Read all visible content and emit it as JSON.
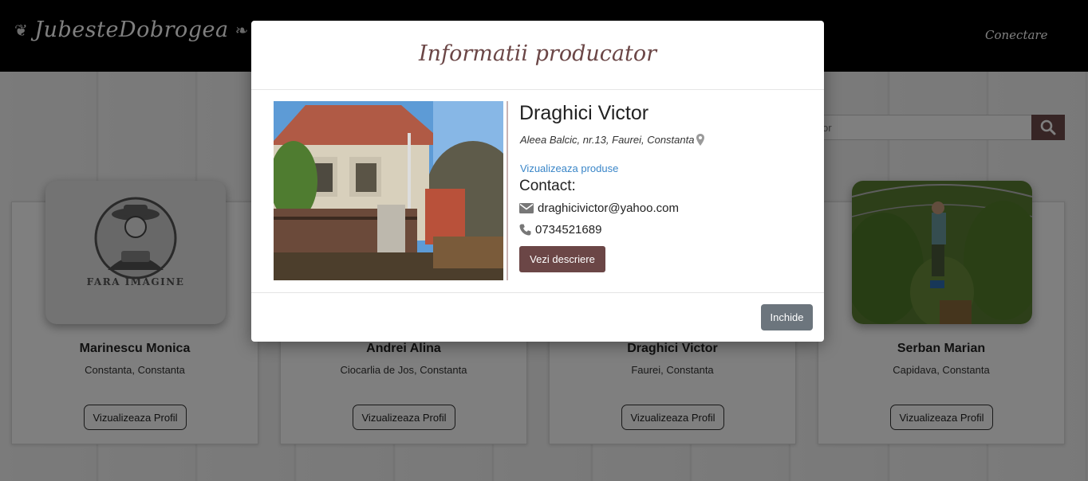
{
  "navbar": {
    "brand": "JubesteDobrogea",
    "login": "Conectare"
  },
  "search": {
    "placeholder": "or"
  },
  "cards": [
    {
      "name": "Marinescu Monica",
      "location": "Constanta, Constanta",
      "button": "Vizualizeaza Profil",
      "image": "fara-imagine-placeholder",
      "placeholder_text": "FARA IMAGINE"
    },
    {
      "name": "Andrei Alina",
      "location": "Ciocarlia de Jos, Constanta",
      "button": "Vizualizeaza Profil"
    },
    {
      "name": "Draghici Victor",
      "location": "Faurei, Constanta",
      "button": "Vizualizeaza Profil"
    },
    {
      "name": "Serban Marian",
      "location": "Capidava, Constanta",
      "button": "Vizualizeaza Profil",
      "image": "greenhouse-photo"
    }
  ],
  "modal": {
    "title": "Informatii producator",
    "producer": {
      "name": "Draghici Victor",
      "address": "Aleea Balcic, nr.13, Faurei, Constanta",
      "view_products": "Vizualizeaza produse",
      "contact_label": "Contact:",
      "email": "draghicivictor@yahoo.com",
      "phone": "0734521689",
      "description_button": "Vezi descriere"
    },
    "close_button": "Inchide"
  },
  "colors": {
    "accent": "#6b4646",
    "link": "#3a86c8",
    "close_button": "#6c757d"
  }
}
